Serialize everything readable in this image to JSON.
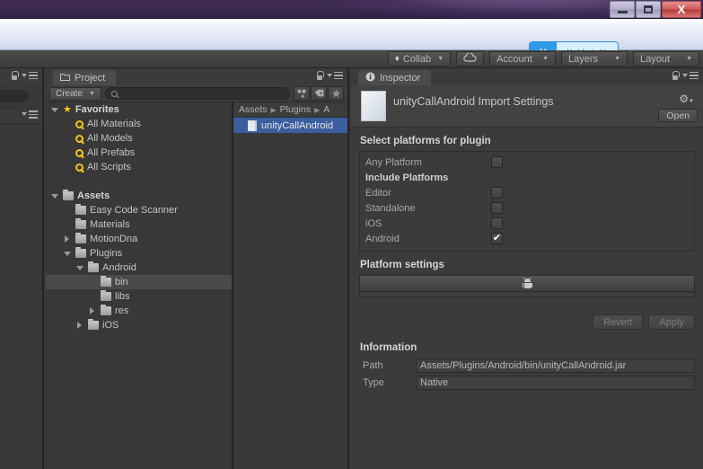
{
  "window": {
    "minimize_label": "Minimize",
    "maximize_label": "Restore",
    "close_label": "X"
  },
  "browser_bar": {
    "upload_button_label": "拖拽上传",
    "upload_icon": "cloud-link-icon"
  },
  "unity_toolbar": {
    "collab_label": "Collab",
    "collab_icon": "collab-shield-icon",
    "cloud_icon": "cloud-icon",
    "account_label": "Account",
    "layers_label": "Layers",
    "layout_label": "Layout",
    "caret": "▼"
  },
  "project_panel": {
    "tab_label": "Project",
    "tab_icon": "folder-icon",
    "lock_icon": "lock-icon",
    "menu_icon": "hamburger-menu-icon",
    "create_label": "Create",
    "create_caret": "▼",
    "search_placeholder": "",
    "search_value": "",
    "search_icon": "search-icon",
    "filter_icons": [
      "asset-type-filter-icon",
      "label-filter-icon",
      "favorite-filter-icon"
    ],
    "tree": [
      {
        "label": "Favorites",
        "depth": 0,
        "icon": "star-icon",
        "twisty": "down",
        "bold": true,
        "selected": false
      },
      {
        "label": "All Materials",
        "depth": 1,
        "icon": "search-icon",
        "twisty": "none",
        "bold": false,
        "selected": false
      },
      {
        "label": "All Models",
        "depth": 1,
        "icon": "search-icon",
        "twisty": "none",
        "bold": false,
        "selected": false
      },
      {
        "label": "All Prefabs",
        "depth": 1,
        "icon": "search-icon",
        "twisty": "none",
        "bold": false,
        "selected": false
      },
      {
        "label": "All Scripts",
        "depth": 1,
        "icon": "search-icon",
        "twisty": "none",
        "bold": false,
        "selected": false
      },
      {
        "label": "",
        "depth": 0,
        "icon": "none",
        "twisty": "none",
        "bold": false,
        "selected": false
      },
      {
        "label": "Assets",
        "depth": 0,
        "icon": "folder-icon",
        "twisty": "down",
        "bold": true,
        "selected": false
      },
      {
        "label": "Easy Code Scanner",
        "depth": 1,
        "icon": "folder-icon",
        "twisty": "none",
        "bold": false,
        "selected": false
      },
      {
        "label": "Materials",
        "depth": 1,
        "icon": "folder-icon",
        "twisty": "none",
        "bold": false,
        "selected": false
      },
      {
        "label": "MotionDna",
        "depth": 1,
        "icon": "folder-icon",
        "twisty": "right",
        "bold": false,
        "selected": false
      },
      {
        "label": "Plugins",
        "depth": 1,
        "icon": "folder-icon",
        "twisty": "down",
        "bold": false,
        "selected": false
      },
      {
        "label": "Android",
        "depth": 2,
        "icon": "folder-icon",
        "twisty": "down",
        "bold": false,
        "selected": false
      },
      {
        "label": "bin",
        "depth": 3,
        "icon": "folder-icon",
        "twisty": "none",
        "bold": false,
        "selected": true
      },
      {
        "label": "libs",
        "depth": 3,
        "icon": "folder-icon",
        "twisty": "none",
        "bold": false,
        "selected": false
      },
      {
        "label": "res",
        "depth": 3,
        "icon": "folder-icon",
        "twisty": "right",
        "bold": false,
        "selected": false
      },
      {
        "label": "iOS",
        "depth": 2,
        "icon": "folder-icon",
        "twisty": "right",
        "bold": false,
        "selected": false
      }
    ],
    "breadcrumb": [
      "Assets",
      "Plugins",
      "A"
    ],
    "breadcrumb_separator": "▶",
    "files": [
      {
        "label": "unityCallAndroid",
        "icon": "file-icon",
        "selected": true
      }
    ]
  },
  "inspector": {
    "tab_label": "Inspector",
    "tab_icon": "info-icon",
    "lock_icon": "lock-icon",
    "menu_icon": "hamburger-menu-icon",
    "title": "unityCallAndroid Import Settings",
    "asset_icon": "file-icon",
    "gear_icon": "gear-icon",
    "open_button_label": "Open",
    "platforms_section_title": "Select platforms for plugin",
    "any_platform": {
      "label": "Any Platform",
      "checked": false
    },
    "include_platforms_title": "Include Platforms",
    "platforms": [
      {
        "label": "Editor",
        "checked": false
      },
      {
        "label": "Standalone",
        "checked": false
      },
      {
        "label": "iOS",
        "checked": false
      },
      {
        "label": "Android",
        "checked": true
      }
    ],
    "checkmark": "✔",
    "platform_settings_title": "Platform settings",
    "platform_tab_icon": "android-robot-icon",
    "revert_label": "Revert",
    "apply_label": "Apply",
    "information_title": "Information",
    "info_rows": [
      {
        "label": "Path",
        "value": "Assets/Plugins/Android/bin/unityCallAndroid.jar"
      },
      {
        "label": "Type",
        "value": "Native"
      }
    ]
  }
}
